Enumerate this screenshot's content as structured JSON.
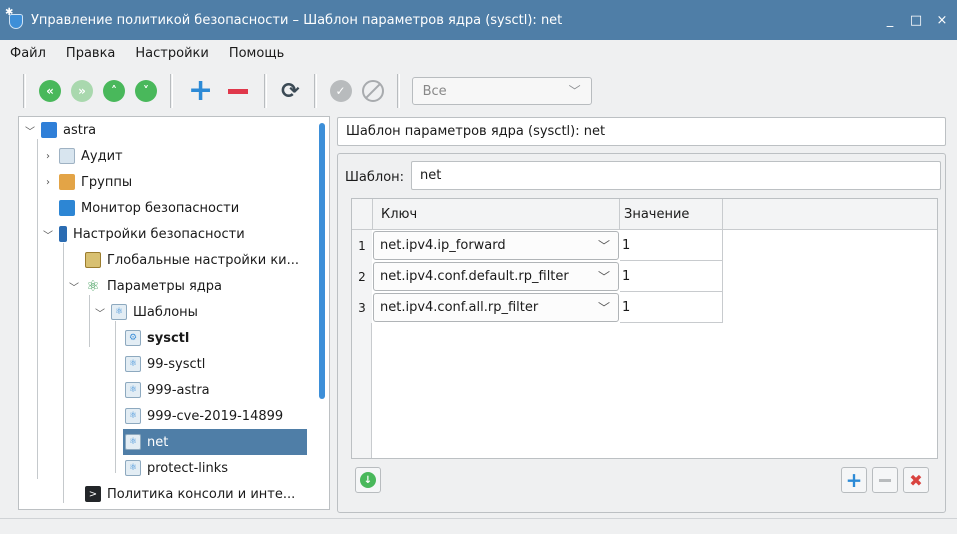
{
  "window": {
    "title": "Управление политикой безопасности – Шаблон параметров ядра (sysctl): net",
    "minimize": "_",
    "maximize": "□",
    "close": "×"
  },
  "menu": [
    "Файл",
    "Правка",
    "Настройки",
    "Помощь"
  ],
  "toolbar": {
    "filter_value": "Все",
    "icons": [
      "first-icon",
      "next-icon",
      "up-icon",
      "down-icon",
      "add-icon",
      "remove-icon",
      "refresh-icon",
      "apply-icon",
      "cancel-icon"
    ]
  },
  "tree": {
    "items": [
      {
        "label": "astra",
        "icon": "monitor-icon"
      },
      {
        "label": "Аудит",
        "icon": "audit-icon"
      },
      {
        "label": "Группы",
        "icon": "groups-icon"
      },
      {
        "label": "Монитор безопасности",
        "icon": "lock-icon"
      },
      {
        "label": "Настройки безопасности",
        "icon": "settings-icon"
      },
      {
        "label": "Глобальные настройки ки...",
        "icon": "pages-icon"
      },
      {
        "label": "Параметры ядра",
        "icon": "atom-icon"
      },
      {
        "label": "Шаблоны",
        "icon": "template-icon"
      },
      {
        "label": "sysctl",
        "icon": "template-gear-icon"
      },
      {
        "label": "99-sysctl",
        "icon": "template-icon"
      },
      {
        "label": "999-astra",
        "icon": "template-icon"
      },
      {
        "label": "999-cve-2019-14899",
        "icon": "template-icon"
      },
      {
        "label": "net",
        "icon": "template-icon",
        "selected": true
      },
      {
        "label": "protect-links",
        "icon": "template-icon"
      },
      {
        "label": "Политика консоли и инте...",
        "icon": "terminal-icon"
      }
    ]
  },
  "panel": {
    "header": "Шаблон параметров ядра (sysctl): net",
    "template_label": "Шаблон:",
    "template_value": "net"
  },
  "table": {
    "columns": [
      "Ключ",
      "Значение"
    ],
    "rows": [
      {
        "num": "1",
        "key": "net.ipv4.ip_forward",
        "value": "1"
      },
      {
        "num": "2",
        "key": "net.ipv4.conf.default.rp_filter",
        "value": "1"
      },
      {
        "num": "3",
        "key": "net.ipv4.conf.all.rp_filter",
        "value": "1"
      }
    ]
  },
  "colors": {
    "titlebar": "#4f7ea7",
    "selection": "#4f7ea7",
    "accent": "#3d8fd8",
    "green": "#49b85b",
    "red": "#e0384b"
  }
}
